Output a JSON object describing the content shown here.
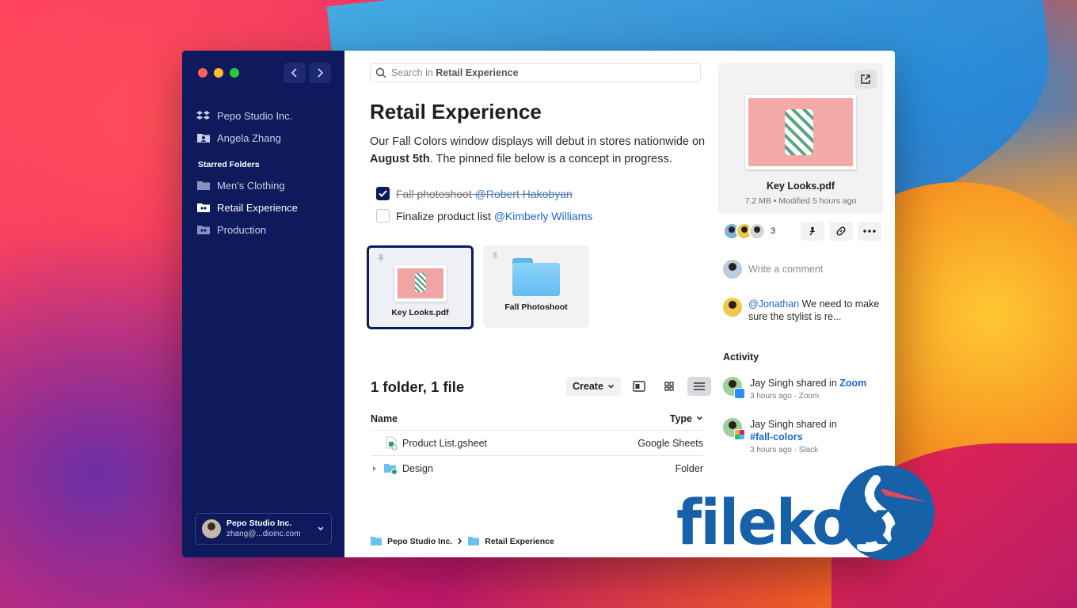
{
  "sidebar": {
    "items_top": [
      {
        "label": "Pepo Studio Inc.",
        "icon": "dropbox-icon"
      },
      {
        "label": "Angela Zhang",
        "icon": "person-folder-icon"
      }
    ],
    "starred_heading": "Starred Folders",
    "starred": [
      {
        "label": "Men's Clothing",
        "icon": "folder-icon"
      },
      {
        "label": "Retail Experience",
        "icon": "shared-folder-icon",
        "active": true
      },
      {
        "label": "Production",
        "icon": "shared-folder-icon"
      }
    ],
    "account": {
      "name": "Pepo Studio Inc.",
      "email": "zhang@...dioinc.com"
    }
  },
  "search": {
    "prefix": "Search in",
    "scope": "Retail Experience"
  },
  "main": {
    "title": "Retail Experience",
    "desc_1": "Our Fall Colors window displays will debut in stores nationwide on ",
    "desc_bold": "August 5th",
    "desc_2": ". The pinned file below is a concept in progress.",
    "todos": [
      {
        "text": "Fall photoshoot",
        "mention": "@Robert Hakobyan",
        "done": true
      },
      {
        "text": "Finalize product list",
        "mention": "@Kimberly Williams",
        "done": false
      }
    ],
    "pinned": [
      {
        "label": "Key Looks.pdf"
      },
      {
        "label": "Fall Photoshoot"
      }
    ],
    "count": "1 folder, 1 file",
    "create_label": "Create",
    "columns": {
      "name": "Name",
      "type": "Type"
    },
    "rows": [
      {
        "name": "Product List.gsheet",
        "type": "Google Sheets"
      },
      {
        "name": "Design",
        "type": "Folder"
      }
    ],
    "breadcrumb": [
      "Pepo Studio Inc.",
      "Retail Experience"
    ]
  },
  "panel": {
    "file_name": "Key Looks.pdf",
    "file_meta": "7.2 MB • Modified 5 hours ago",
    "member_count": "3",
    "comment_placeholder": "Write a comment",
    "comment": {
      "mention": "@Jonathan",
      "text": " We need to make sure the stylist is re..."
    },
    "activity_title": "Activity",
    "activity": [
      {
        "text": "Jay Singh shared in ",
        "target": "Zoom",
        "sub": "3 hours ago · Zoom"
      },
      {
        "text": "Jay Singh shared in ",
        "target": "#fall-colors",
        "sub": "3 hours ago · Slack"
      }
    ]
  },
  "watermark": {
    "text": "filekoka"
  },
  "colors": {
    "sidebar": "#0e1a5c",
    "accent": "#1a66d2"
  }
}
